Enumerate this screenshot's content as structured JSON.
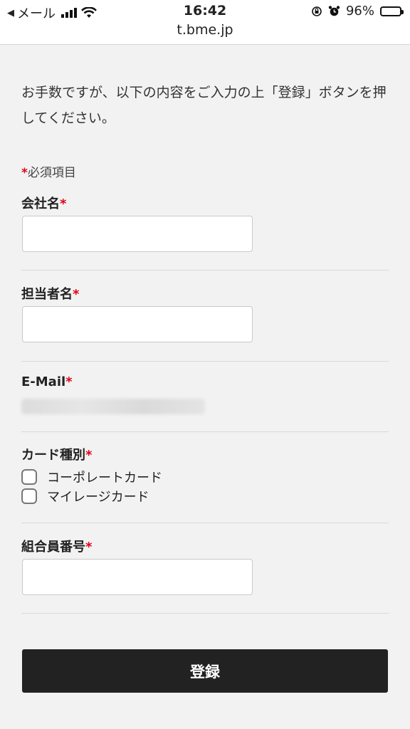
{
  "status_bar": {
    "back_label": "◀",
    "carrier": "メール",
    "time": "16:42",
    "url": "t.bme.jp",
    "battery_percent": "96%",
    "battery_level": 0.96,
    "icons": [
      "signal-icon",
      "wifi-icon",
      "rotation-lock-icon",
      "alarm-icon",
      "battery-icon"
    ]
  },
  "form": {
    "intro": "お手数ですが、以下の内容をご入力の上「登録」ボタンを押してください。",
    "required_mark": "*",
    "required_note": "必須項目",
    "company_label": "会社名",
    "company_value": "",
    "person_label": "担当者名",
    "person_value": "",
    "email_label": "E-Mail",
    "email_value": "",
    "card_type_label": "カード種別",
    "card_options": [
      {
        "label": "コーポレートカード",
        "checked": false
      },
      {
        "label": "マイレージカード",
        "checked": false
      }
    ],
    "member_number_label": "組合員番号",
    "member_number_value": "",
    "submit_label": "登録"
  },
  "colors": {
    "required": "#e0001a",
    "button_bg": "#222222",
    "page_bg": "#f2f2f2"
  }
}
